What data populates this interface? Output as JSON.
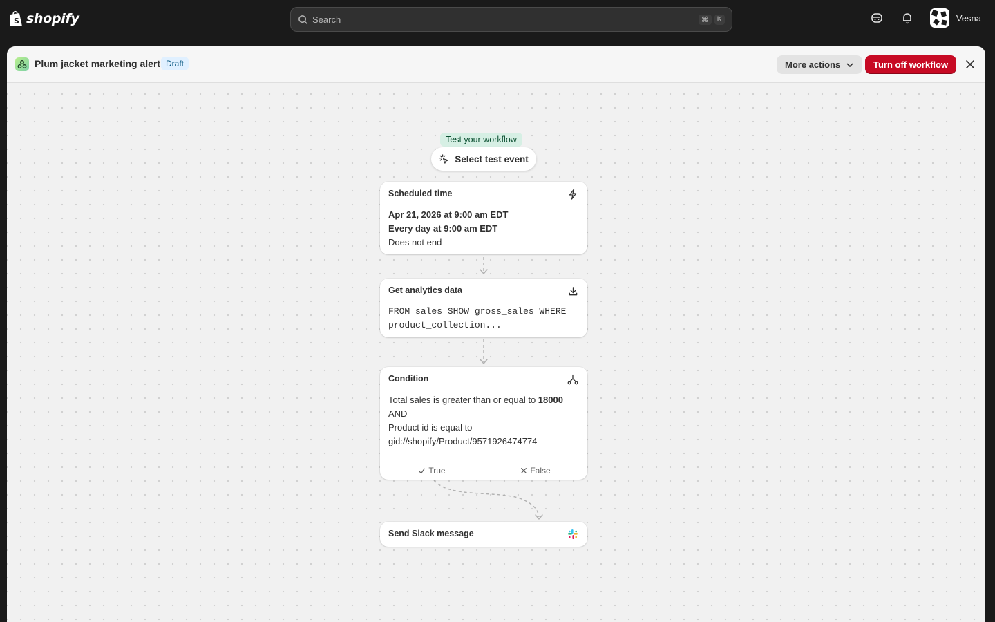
{
  "app": {
    "brand": "shopify",
    "user_name": "Vesna"
  },
  "search": {
    "placeholder": "Search",
    "shortcut_keys": [
      "⌘",
      "K"
    ]
  },
  "header": {
    "title": "Plum jacket marketing alert",
    "status_badge": "Draft",
    "more_actions_label": "More actions",
    "turn_off_label": "Turn off workflow"
  },
  "test": {
    "label": "Test your workflow",
    "button_label": "Select test event"
  },
  "steps": {
    "trigger": {
      "title": "Scheduled time",
      "line1": "Apr 21, 2026 at 9:00 am EDT",
      "line2": "Every day at 9:00 am EDT",
      "line3": "Does not end",
      "icon": "lightning-icon"
    },
    "analytics": {
      "title": "Get analytics data",
      "query_line1": "FROM sales SHOW gross_sales WHERE",
      "query_line2": "product_collection...",
      "icon": "download-icon"
    },
    "condition": {
      "title": "Condition",
      "rule1_text": "Total sales is greater than or equal to ",
      "rule1_value": "18000",
      "operator": "AND",
      "rule2_text": "Product id is equal to",
      "rule2_value": "gid://shopify/Product/9571926474774",
      "true_label": "True",
      "false_label": "False",
      "icon": "branch-icon"
    },
    "slack": {
      "title": "Send Slack message",
      "icon": "slack-icon"
    }
  },
  "colors": {
    "danger": "#c70a24",
    "badge_bg": "#e0f0ff",
    "test_bg": "#d6efe4"
  }
}
